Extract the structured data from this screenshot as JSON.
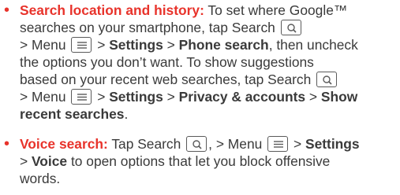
{
  "bullet": "•",
  "items": [
    {
      "lead": "Search location and history:",
      "lines": [
        {
          "a": " To set where Google™"
        },
        {
          "a": "searches on your smartphone, tap Search"
        },
        {
          "a": "> Menu",
          "b": "> ",
          "bold1": "Settings",
          "c": " > ",
          "bold2": "Phone search",
          "d": ", then uncheck"
        },
        {
          "a": "the options you don’t want. To show suggestions"
        },
        {
          "a": "based on your recent web searches, tap Search"
        },
        {
          "a": "> Menu",
          "b": "> ",
          "bold1": "Settings",
          "c": " > ",
          "bold2": "Privacy & accounts",
          "d": " > ",
          "bold3": "Show"
        },
        {
          "bold1": "recent searches",
          "a": "."
        }
      ]
    },
    {
      "lead": "Voice search:",
      "lines": [
        {
          "a": " Tap Search",
          "b": ", > Menu",
          "c": "> ",
          "bold1": "Settings"
        },
        {
          "a": "> ",
          "bold1": "Voice",
          "b": " to open options that let you block offensive"
        },
        {
          "a": "words."
        }
      ]
    }
  ],
  "icons": {
    "search": "search-icon",
    "menu": "menu-icon"
  },
  "colors": {
    "accent": "#e8332b",
    "text": "#3a3a3a"
  }
}
